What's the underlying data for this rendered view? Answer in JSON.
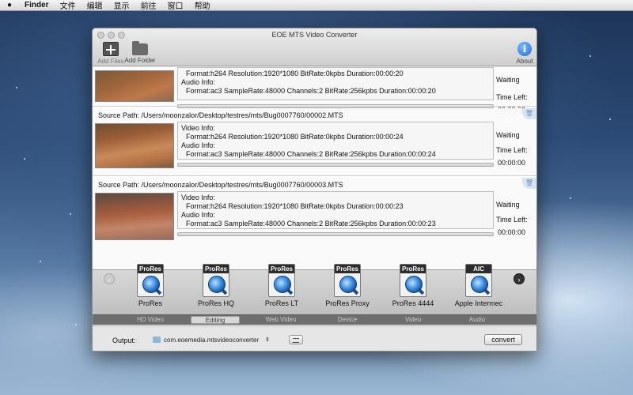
{
  "menubar": {
    "app": "Finder",
    "items": [
      "文件",
      "编辑",
      "显示",
      "前往",
      "窗口",
      "帮助"
    ]
  },
  "window": {
    "title": "EOE MTS Video Converter",
    "toolbar": {
      "add_files": "Add Files",
      "add_folder": "Add Folder",
      "about": "About",
      "info_glyph": "i"
    }
  },
  "files": [
    {
      "source_label": "",
      "source_path": "",
      "video_label": "",
      "video_info": "Format:h264 Resolution:1920*1080 BitRate:0kpbs Duration:00:00:20",
      "audio_label": "Audio Info:",
      "audio_info": "Format:ac3 SampleRate:48000 Channels:2 BitRate:256kpbs Duration:00:00:20",
      "status": "Waiting",
      "time_left_label": "Time Left:",
      "time_left": "00:00:00",
      "progress": 0
    },
    {
      "source_label": "Source Path:",
      "source_path": "/Users/moonzalor/Desktop/testres/mts/Bug0007760/00002.MTS",
      "video_label": "Video Info:",
      "video_info": "Format:h264 Resolution:1920*1080 BitRate:0kpbs Duration:00:00:24",
      "audio_label": "Audio Info:",
      "audio_info": "Format:ac3 SampleRate:48000 Channels:2 BitRate:256kpbs Duration:00:00:24",
      "status": "Waiting",
      "time_left_label": "Time Left:",
      "time_left": "00:00:00",
      "progress": 0
    },
    {
      "source_label": "Source Path:",
      "source_path": "/Users/moonzalor/Desktop/testres/mts/Bug0007760/00003.MTS",
      "video_label": "Video Info:",
      "video_info": "Format:h264 Resolution:1920*1080 BitRate:0kpbs Duration:00:00:23",
      "audio_label": "Audio Info:",
      "audio_info": "Format:ac3 SampleRate:48000 Channels:2 BitRate:256kpbs Duration:00:00:23",
      "status": "Waiting",
      "time_left_label": "Time Left:",
      "time_left": "00:00:00",
      "progress": 0
    }
  ],
  "formats": [
    {
      "tag": "ProRes",
      "label": "ProRes"
    },
    {
      "tag": "ProRes",
      "label": "ProRes HQ"
    },
    {
      "tag": "ProRes",
      "label": "ProRes LT"
    },
    {
      "tag": "ProRes",
      "label": "ProRes Proxy"
    },
    {
      "tag": "ProRes",
      "label": "ProRes 4444"
    },
    {
      "tag": "AIC",
      "label": "Apple Intermec"
    }
  ],
  "categories": [
    {
      "label": "HD Video",
      "active": false
    },
    {
      "label": "Editing",
      "active": true
    },
    {
      "label": "Web Video",
      "active": false
    },
    {
      "label": "Device",
      "active": false
    },
    {
      "label": "Video",
      "active": false
    },
    {
      "label": "Audio",
      "active": false
    }
  ],
  "output": {
    "label": "Output:",
    "path": "com.eoemedia.mtsvideoconverter",
    "dropdown_glyph": "⇕",
    "convert_label": "convert"
  },
  "icons": {
    "apple": "apple-icon",
    "add_files": "add-files-icon",
    "add_folder": "folder-icon",
    "about": "info-icon",
    "trash": "trash-icon",
    "prev": "chevron-left-icon",
    "next": "chevron-right-icon"
  },
  "colors": {
    "info_blue": "#1f6ad6",
    "category_bar": "#6e6e6e"
  }
}
